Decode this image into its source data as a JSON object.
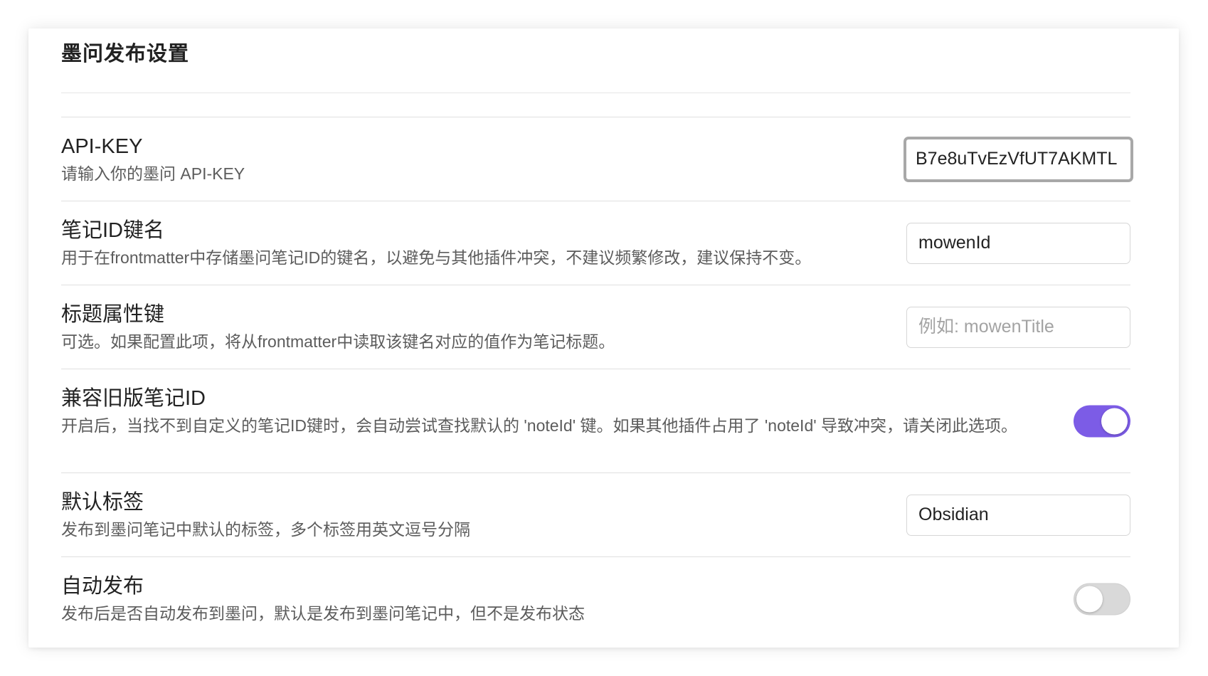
{
  "section": {
    "title": "墨问发布设置"
  },
  "settings": {
    "api_key": {
      "name": "API-KEY",
      "desc": "请输入你的墨问 API-KEY",
      "value": "B7e8uTvEzVfUT7AKMTL"
    },
    "note_id_key": {
      "name": "笔记ID键名",
      "desc": "用于在frontmatter中存储墨问笔记ID的键名，以避免与其他插件冲突，不建议频繁修改，建议保持不变。",
      "value": "mowenId"
    },
    "title_key": {
      "name": "标题属性键",
      "desc": "可选。如果配置此项，将从frontmatter中读取该键名对应的值作为笔记标题。",
      "value": "",
      "placeholder": "例如: mowenTitle"
    },
    "legacy_id": {
      "name": "兼容旧版笔记ID",
      "desc": "开启后，当找不到自定义的笔记ID键时，会自动尝试查找默认的 'noteId' 键。如果其他插件占用了 'noteId' 导致冲突，请关闭此选项。",
      "enabled": true
    },
    "default_tags": {
      "name": "默认标签",
      "desc": "发布到墨问笔记中默认的标签，多个标签用英文逗号分隔",
      "value": "Obsidian"
    },
    "auto_publish": {
      "name": "自动发布",
      "desc": "发布后是否自动发布到墨问，默认是发布到墨问笔记中，但不是发布状态",
      "enabled": false
    }
  },
  "colors": {
    "accent": "#7c5ce6",
    "toggle_off": "#d9d9d9",
    "focused_border": "#a8a8a8"
  }
}
